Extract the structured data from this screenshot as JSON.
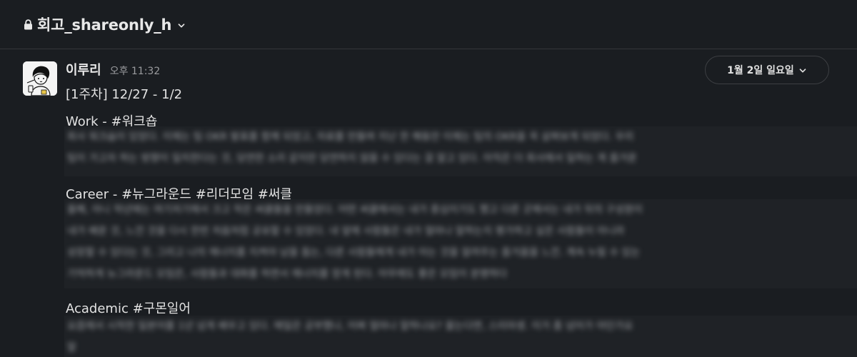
{
  "header": {
    "channel_name": "회고_shareonly_h",
    "lock_icon": "lock-icon",
    "dropdown_icon": "chevron-down-icon"
  },
  "message": {
    "author": "이루리",
    "time": "오후 11:32",
    "date_pill": "1월 2일 일요일",
    "week_title": "[1주차] 12/27 - 1/2",
    "sections": [
      {
        "heading": "Work - #워크숍",
        "blurred_lines": [
          "회사 워크숍이 있었다. 이제는 팀 OKR 발표를 함께 되었고, 자료를 만들며 지난 한 해동안 이제는 팀의 OKR을 꼭 살펴보게 되었다. 우리",
          "팀이 가고자 하는 방향이 일치한다는 것, 당연한 소리 같지만 당연하지 않을 수 있다는 걸 알고 있다. 아직은 더 회사에서 일하는 게 즐거운"
        ]
      },
      {
        "heading": "Career - #뉴그라운드 #리더모임 #써클",
        "blurred_lines": [
          "올해, 아니 작년에는 여기저기에서 크고 작은 써클들을 만들었다. 어떤 써클에서는 내가 중심이기도 했고 다른 곳에서는 내가 뒤의 구성원이",
          "내가 배운 것, 느낀 것을 다시 한번 처음처럼 공유할 수 있었다. 내 앞에 사람들은 내가 얼마나 말하는지 평가하고 싶은 사람들이 아니라",
          "성장할 수 있다는 것, 그리고 나의 에너지를 지켜야 남을 돕는, 다른 사람들에게 내가 아는 것을 알려주는 즐거움을 느낀. 계속 누릴 수 있는",
          "기억하게 뉴그라운드 모임은, 사람들과 대화를 하면서 에너지를 얻게 된다. 아무래도 좋은 모임이 분명하다"
        ]
      },
      {
        "heading": "Academic #구몬일어",
        "blurred_lines": [
          "요즘에서 시작한 일본어를 1년 넘게 배우고 있다. 매일은 공부했나, 어쩌 얼마나 말하나요? 물는다면, 스미마셍. 이거 좀 넘어가 야던가요",
          "말"
        ]
      }
    ]
  }
}
